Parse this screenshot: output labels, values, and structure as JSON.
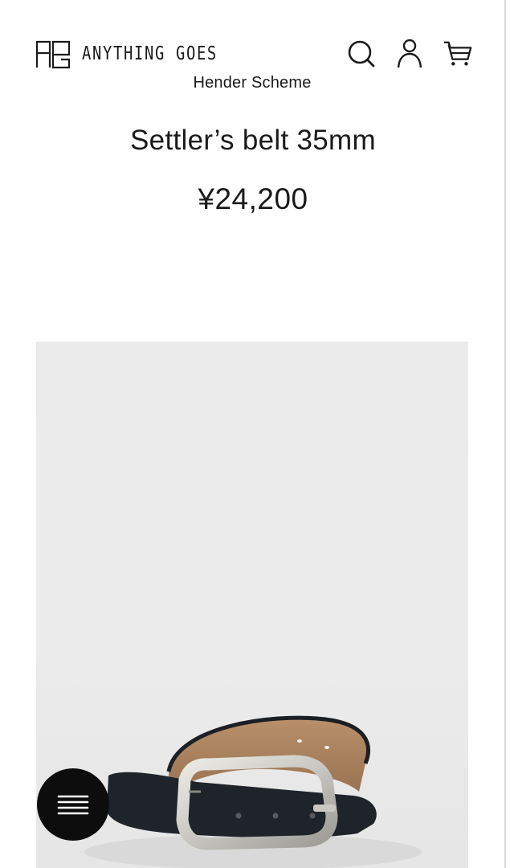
{
  "header": {
    "logo_text": "ANYTHING GOES",
    "icons": [
      "search-icon",
      "account-icon",
      "cart-icon"
    ]
  },
  "product": {
    "brand": "Hender Scheme",
    "title": "Settler’s belt 35mm",
    "price": "¥24,200",
    "image": "leather-belt-with-silver-buckle"
  },
  "menu": {
    "icon": "hamburger-menu-icon"
  },
  "colors": {
    "text": "#1a1a1a",
    "image_background": "#ebebeb",
    "menu_button": "#0d0d0d"
  }
}
